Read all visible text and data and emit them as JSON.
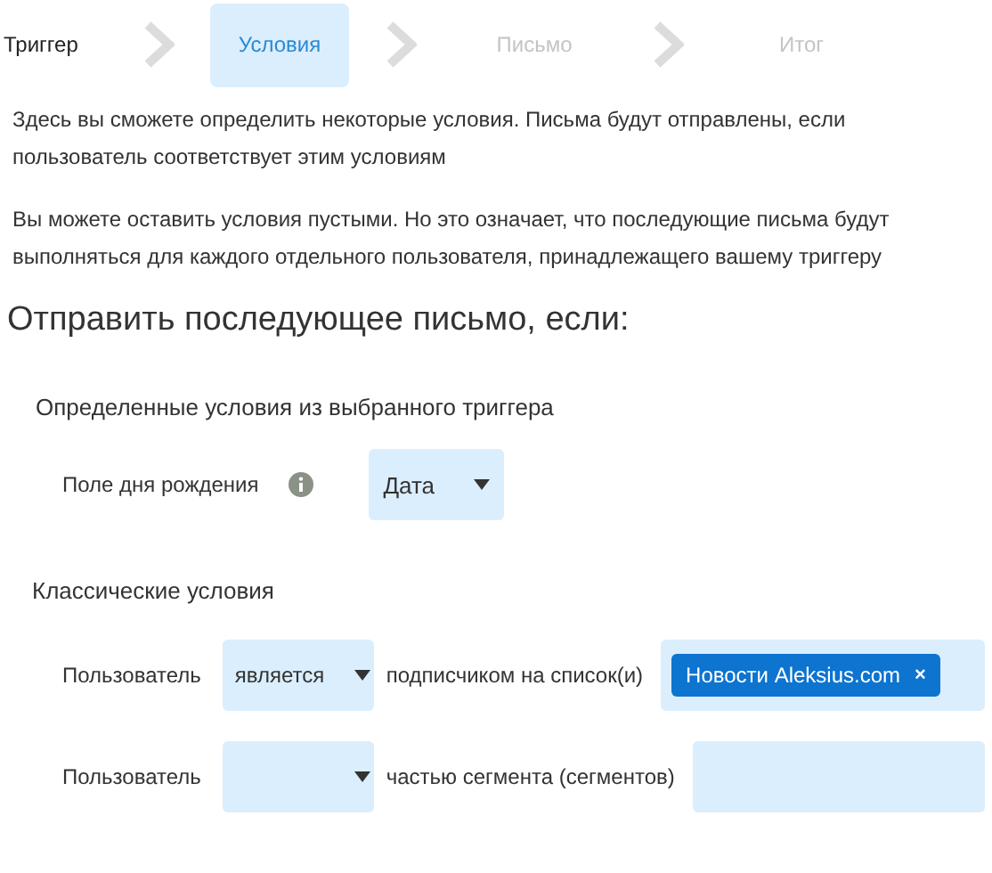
{
  "steps": [
    {
      "label": "Триггер",
      "selected": false,
      "disabled": false
    },
    {
      "label": "Условия",
      "selected": true,
      "disabled": false
    },
    {
      "label": "Письмо",
      "selected": false,
      "disabled": true
    },
    {
      "label": "Итог",
      "selected": false,
      "disabled": true
    }
  ],
  "intro": [
    "Здесь вы сможете определить некоторые условия. Письма будут отправлены, если пользователь соответствует этим условиям",
    "Вы можете оставить условия пустыми. Но это означает, что последующие письма будут выполняться для каждого отдельного пользователя, принадлежащего вашему триггеру"
  ],
  "heading": "Отправить последующее письмо, если:",
  "trigger_section": {
    "title": "Определенные условия из выбранного триггера",
    "birthday_field": {
      "label": "Поле дня рождения",
      "value": "Дата"
    }
  },
  "classic_section": {
    "title": "Классические условия",
    "rows": [
      {
        "subject": "Пользователь",
        "operator": "является",
        "relation": "подписчиком на список(и)",
        "tags": [
          {
            "label": "Новости Aleksius.com",
            "remove": "×"
          }
        ]
      },
      {
        "subject": "Пользователь",
        "operator": "",
        "relation": "частью сегмента (сегментов)",
        "tags": []
      }
    ]
  }
}
